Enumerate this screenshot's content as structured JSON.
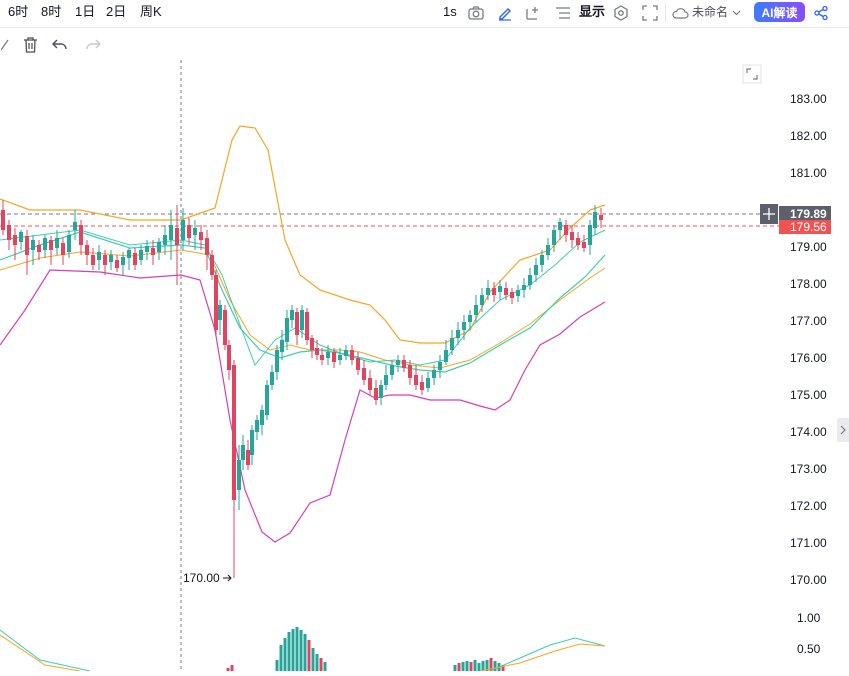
{
  "timeframes": [
    "6时",
    "8时",
    "1日",
    "2日",
    "周K"
  ],
  "toolbar": {
    "interval": "1s",
    "display_label": "显示",
    "unnamed_label": "未命名",
    "ai_label": "AI解读"
  },
  "price_axis": {
    "labels": [
      "183.00",
      "182.00",
      "181.00",
      "179.00",
      "178.00",
      "177.00",
      "176.00",
      "175.00",
      "174.00",
      "173.00",
      "172.00",
      "171.00",
      "170.00"
    ],
    "current_price": "179.89",
    "last_price": "179.56",
    "volume_labels": [
      "1.00",
      "0.50"
    ]
  },
  "annotation": {
    "low_label": "170.00"
  },
  "colors": {
    "up": "#26a69a",
    "down": "#e0445e",
    "upper_band": "#f5a623",
    "lower_band": "#d63fb8",
    "ma": "#3ccfb0",
    "current_price_bg": "#5d606b",
    "last_price_bg": "#f15353",
    "ai_grad_start": "#3d7bff",
    "ai_grad_end": "#8a4dff"
  },
  "icons": [
    "camera-icon",
    "pencil-icon",
    "plus-box-icon",
    "list-icon",
    "gear-icon",
    "fullscreen-icon",
    "cloud-icon",
    "chevron-down-icon",
    "share-icon",
    "edit-icon",
    "trash-icon",
    "undo-icon",
    "redo-icon",
    "expand-icon",
    "plus-icon"
  ]
}
